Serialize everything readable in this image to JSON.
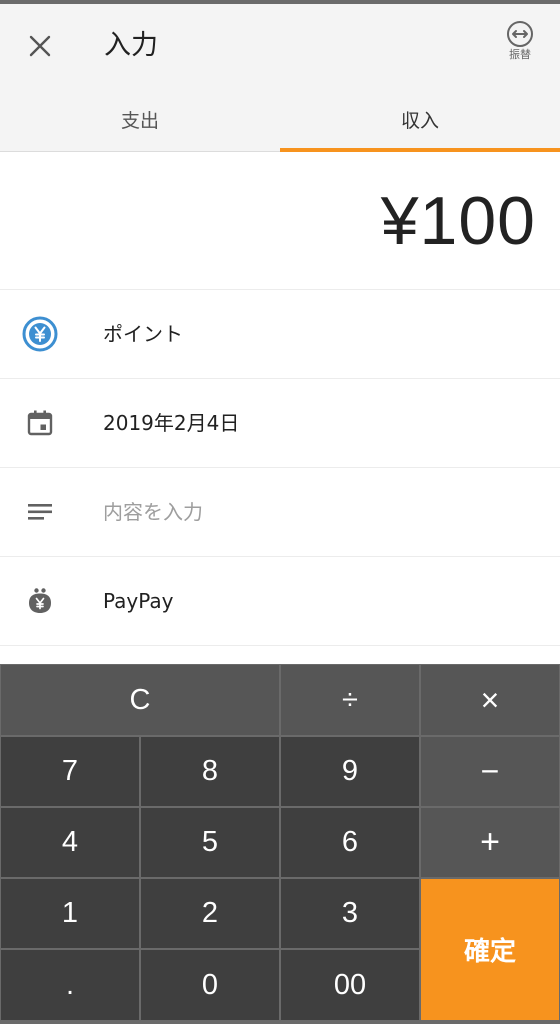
{
  "header": {
    "title": "入力",
    "transfer_label": "振替",
    "close_icon": "close-icon",
    "transfer_icon": "transfer-icon"
  },
  "tabs": [
    {
      "label": "支出",
      "active": false
    },
    {
      "label": "収入",
      "active": true
    }
  ],
  "amount": "¥100",
  "fields": {
    "category": {
      "icon": "yen-coin-icon",
      "value": "ポイント"
    },
    "date": {
      "icon": "calendar-icon",
      "value": "2019年2月4日"
    },
    "memo": {
      "icon": "notes-icon",
      "placeholder": "内容を入力"
    },
    "wallet": {
      "icon": "wallet-icon",
      "value": "PayPay"
    }
  },
  "keypad": {
    "clear": "C",
    "divide": "÷",
    "multiply": "×",
    "minus": "−",
    "plus": "+",
    "confirm": "確定",
    "digits": [
      "7",
      "8",
      "9",
      "4",
      "5",
      "6",
      "1",
      "2",
      "3",
      ".",
      "0",
      "00"
    ]
  },
  "colors": {
    "accent": "#f7931e",
    "header_bg": "#f4f4f4",
    "key_dark": "#3f3f3f",
    "key_operator": "#565656",
    "coin_blue": "#3d8fd1"
  }
}
